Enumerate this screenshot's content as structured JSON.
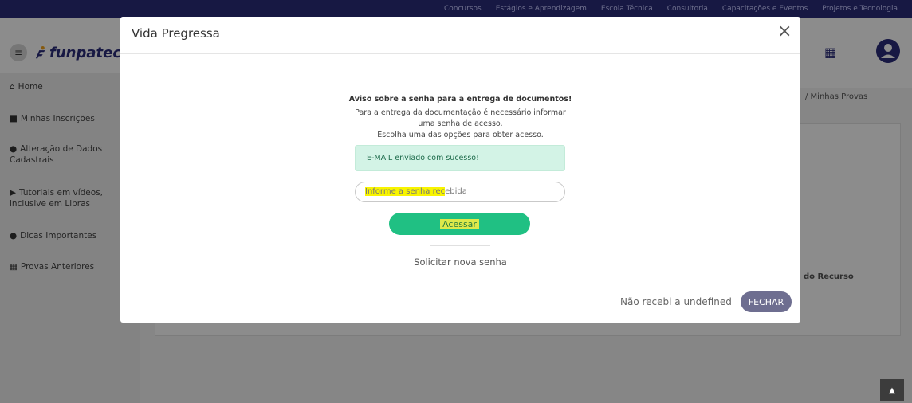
{
  "topbar": {
    "links": [
      "Concursos",
      "Estágios e Aprendizagem",
      "Escola Técnica",
      "Consultoria",
      "Capacitações e Eventos",
      "Projetos e Tecnologia"
    ]
  },
  "header": {
    "brand": "funpatec",
    "menu_icon": "menu-icon",
    "apps_icon": "grid-icon",
    "user_icon": "user-circle-icon"
  },
  "sidebar": {
    "items": [
      {
        "icon": "home-icon",
        "label": "Home"
      },
      {
        "icon": "book-icon",
        "label": "Minhas Inscrições"
      },
      {
        "icon": "user-icon",
        "label": "Alteração de Dados Cadastrais"
      },
      {
        "icon": "play-icon",
        "label": "Tutoriais em vídeos, inclusive em Libras"
      },
      {
        "icon": "lightbulb-icon",
        "label": "Dicas Importantes"
      },
      {
        "icon": "copy-icon",
        "label": "Provas Anteriores"
      }
    ]
  },
  "background": {
    "breadcrumb": "/ Minhas Provas",
    "table_header": "do Recurso"
  },
  "modal": {
    "title": "Vida Pregressa",
    "notice_title": "Aviso sobre a senha para a entrega de documentos!",
    "notice_lines": [
      "Para a entrega da documentação é necessário informar",
      "uma senha de acesso.",
      "Escolha uma das opções para obter acesso."
    ],
    "alert_text": "E-MAIL enviado com sucesso!",
    "password_placeholder_highlighted": "Informe a senha rec",
    "password_placeholder_rest": "ebida",
    "access_label": "Acessar",
    "new_password_link": "Solicitar nova senha",
    "footer_text": "Não recebi a undefined",
    "close_label": "FECHAR"
  }
}
